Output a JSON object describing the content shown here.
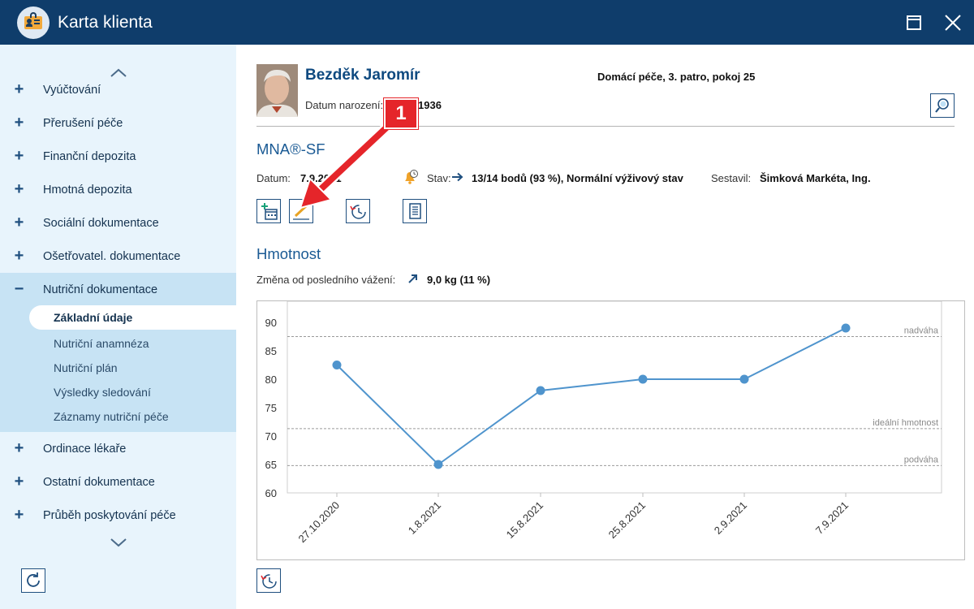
{
  "window": {
    "title": "Karta klienta"
  },
  "sidebar": {
    "items": [
      {
        "sign": "+",
        "label": "Vyúčtování"
      },
      {
        "sign": "+",
        "label": "Přerušení péče"
      },
      {
        "sign": "+",
        "label": "Finanční depozita"
      },
      {
        "sign": "+",
        "label": "Hmotná depozita"
      },
      {
        "sign": "+",
        "label": "Sociální dokumentace"
      },
      {
        "sign": "+",
        "label": "Ošetřovatel. dokumentace"
      },
      {
        "sign": "−",
        "label": "Nutriční dokumentace"
      },
      {
        "sign": "+",
        "label": "Ordinace lékaře"
      },
      {
        "sign": "+",
        "label": "Ostatní dokumentace"
      },
      {
        "sign": "+",
        "label": "Průběh poskytování péče"
      }
    ],
    "subitems": [
      "Základní údaje",
      "Nutriční anamnéza",
      "Nutriční plán",
      "Výsledky sledování",
      "Záznamy nutriční péče"
    ]
  },
  "client": {
    "name": "Bezděk Jaromír",
    "birth_label": "Datum narození:",
    "birth_value": "1936",
    "location": "Domácí péče, 3. patro, pokoj 25"
  },
  "mna": {
    "title": "MNA®-SF",
    "date_label": "Datum:",
    "date_value": "7.9.2021",
    "status_label": "Stav:",
    "status_value": "13/14 bodů (93 %), Normální výživový stav",
    "author_label": "Sestavil:",
    "author_value": "Šimková Markéta, Ing."
  },
  "weight": {
    "title": "Hmotnost",
    "change_label": "Změna od posledního vážení:",
    "change_value": "9,0 kg (11 %)"
  },
  "annotation": {
    "number": "1"
  },
  "chart_data": {
    "type": "line",
    "categories": [
      "27.10.2020",
      "1.8.2021",
      "15.8.2021",
      "25.8.2021",
      "2.9.2021",
      "7.9.2021"
    ],
    "values": [
      82.5,
      65,
      78,
      80,
      80,
      89
    ],
    "ylim": [
      60,
      90
    ],
    "yticks": [
      60,
      65,
      70,
      75,
      80,
      85,
      90
    ],
    "reference_lines": [
      {
        "label": "nadváha",
        "value": 87.5
      },
      {
        "label": "ideální hmotnost",
        "value": 71.3
      },
      {
        "label": "podváha",
        "value": 64.8
      }
    ],
    "line_color": "#4f94cd",
    "grid": false
  }
}
